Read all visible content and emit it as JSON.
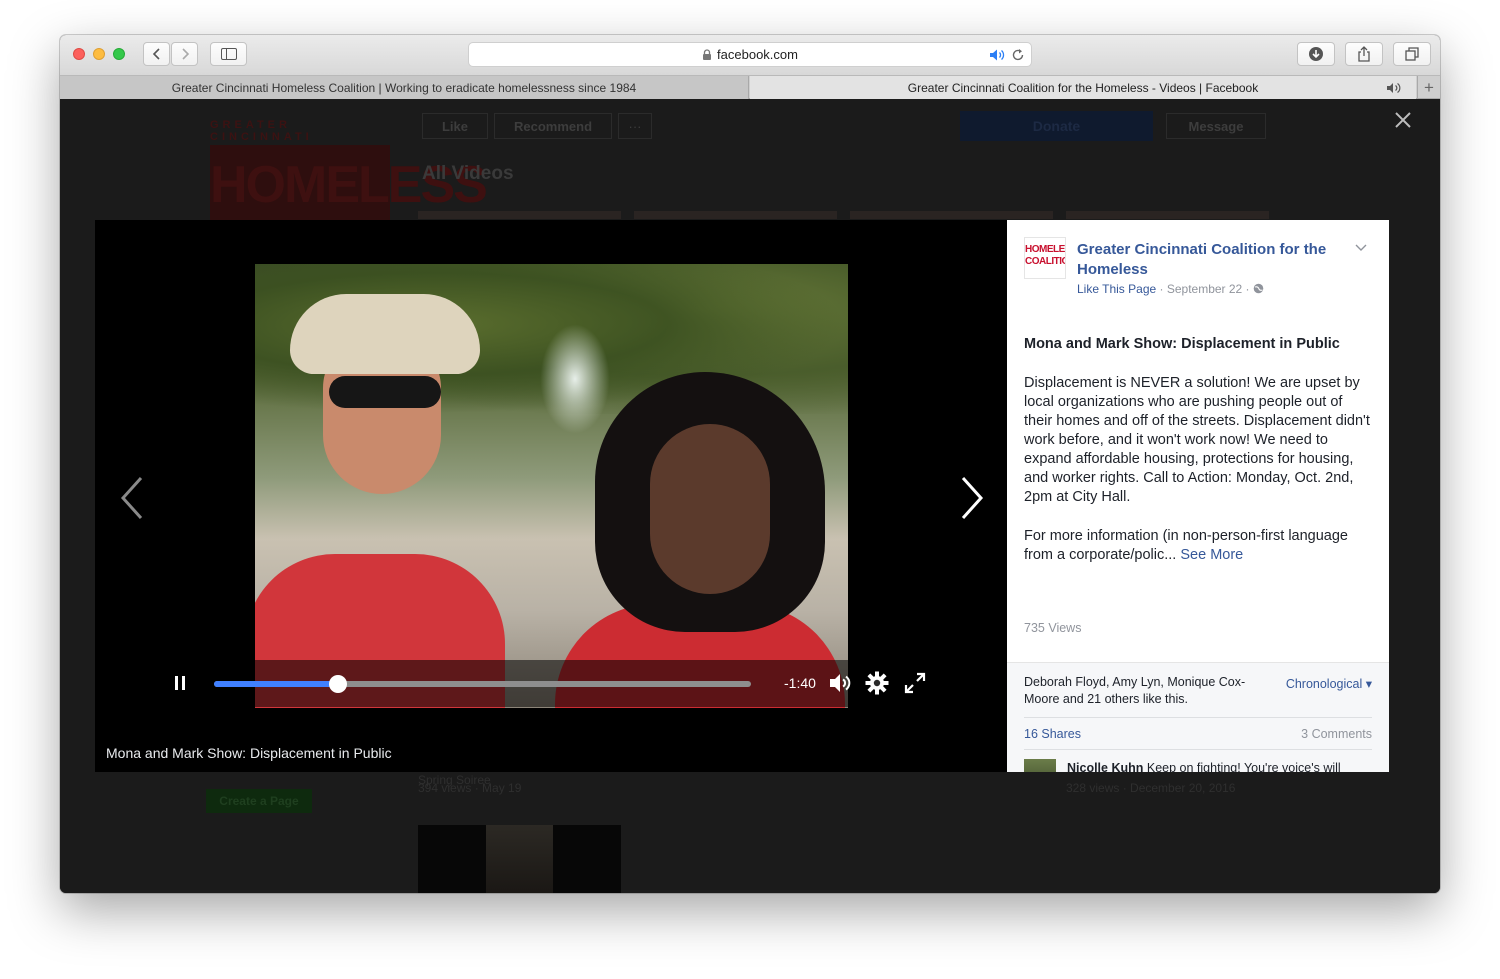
{
  "browser": {
    "url": "facebook.com",
    "tabs": [
      {
        "title": "Greater Cincinnati Homeless Coalition | Working to eradicate homelessness since 1984"
      },
      {
        "title": "Greater Cincinnati Coalition for the Homeless - Videos | Facebook"
      }
    ]
  },
  "background_page": {
    "logo_top": "GREATER CINCINNATI",
    "logo_main": "HOMELESS",
    "like_label": "Like",
    "recommend_label": "Recommend",
    "more_label": "···",
    "donate_label": "Donate",
    "message_label": "Message",
    "section_title": "All Videos",
    "video_left_title": "Spring Soiree",
    "video_left_meta": "394 views · May 19",
    "video_right_meta": "328 views · December 20, 2016",
    "create_page_label": "Create a Page"
  },
  "video": {
    "caption": "Mona and Mark Show: Displacement in Public",
    "time_remaining": "-1:40",
    "progress": 0.23
  },
  "post": {
    "page_name": "Greater Cincinnati Coalition for the Homeless",
    "avatar_text": "HOMELESS COALITION",
    "like_page_label": "Like This Page",
    "date": "· September 22 ·",
    "title": "Mona and Mark Show: Displacement in Public",
    "body": "Displacement is NEVER a solution! We are upset by local organizations who are pushing people out of their homes and off of the streets. Displacement didn't work before, and it won't work now! We need to expand affordable housing, protections for housing, and worker rights. Call to Action: Monday, Oct. 2nd, 2pm at City Hall.",
    "more_info": "For more information (in non-person-first language from a corporate/polic...",
    "see_more": "See More",
    "views": "735 Views",
    "likes_text": "Deborah Floyd, Amy Lyn, Monique Cox-Moore and 21 others like this.",
    "sort_label": "Chronological ▾",
    "shares": "16 Shares",
    "comments_count": "3 Comments",
    "comment_author": "Nicolle Kuhn",
    "comment_text": "Keep on fighting! You're voice's will"
  },
  "colors": {
    "facebook_blue": "#365899",
    "progress_blue": "#4080ff",
    "logo_red": "#c8102e"
  }
}
